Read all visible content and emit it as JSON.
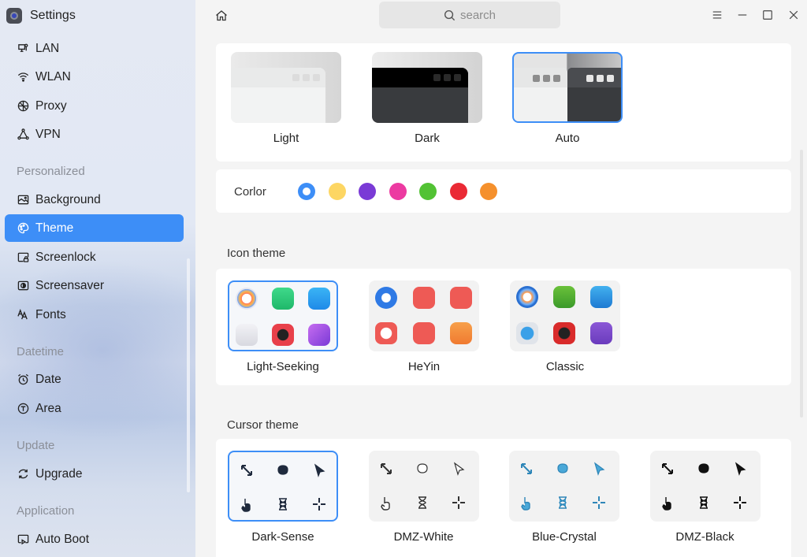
{
  "app": {
    "title": "Settings"
  },
  "sidebar": {
    "items": [
      {
        "label": "LAN",
        "icon": "lan-icon"
      },
      {
        "label": "WLAN",
        "icon": "wifi-icon"
      },
      {
        "label": "Proxy",
        "icon": "proxy-icon"
      },
      {
        "label": "VPN",
        "icon": "vpn-icon"
      },
      {
        "label": "Background",
        "icon": "background-icon"
      },
      {
        "label": "Theme",
        "icon": "palette-icon",
        "active": true
      },
      {
        "label": "Screenlock",
        "icon": "screenlock-icon"
      },
      {
        "label": "Screensaver",
        "icon": "screensaver-icon"
      },
      {
        "label": "Fonts",
        "icon": "fonts-icon"
      },
      {
        "label": "Date",
        "icon": "alarm-clock-icon"
      },
      {
        "label": "Area",
        "icon": "area-icon"
      },
      {
        "label": "Upgrade",
        "icon": "refresh-icon"
      },
      {
        "label": "Auto Boot",
        "icon": "autoboot-icon"
      }
    ],
    "groups": [
      "Personalized",
      "Datetime",
      "Update",
      "Application"
    ]
  },
  "topbar": {
    "search_placeholder": "search"
  },
  "theme_modes": {
    "options": [
      {
        "label": "Light"
      },
      {
        "label": "Dark"
      },
      {
        "label": "Auto",
        "selected": true
      }
    ]
  },
  "color": {
    "label": "Corlor",
    "swatches": [
      "#3d8ef7",
      "#fdd663",
      "#7a3ad6",
      "#ec3aa1",
      "#52c234",
      "#ea2a35",
      "#f5902c"
    ],
    "selected_index": 0
  },
  "icon_theme": {
    "title": "Icon theme",
    "options": [
      {
        "label": "Light-Seeking",
        "selected": true
      },
      {
        "label": "HeYin"
      },
      {
        "label": "Classic"
      }
    ]
  },
  "cursor_theme": {
    "title": "Cursor theme",
    "options": [
      {
        "label": "Dark-Sense",
        "selected": true
      },
      {
        "label": "DMZ-White"
      },
      {
        "label": "Blue-Crystal"
      },
      {
        "label": "DMZ-Black"
      }
    ]
  }
}
